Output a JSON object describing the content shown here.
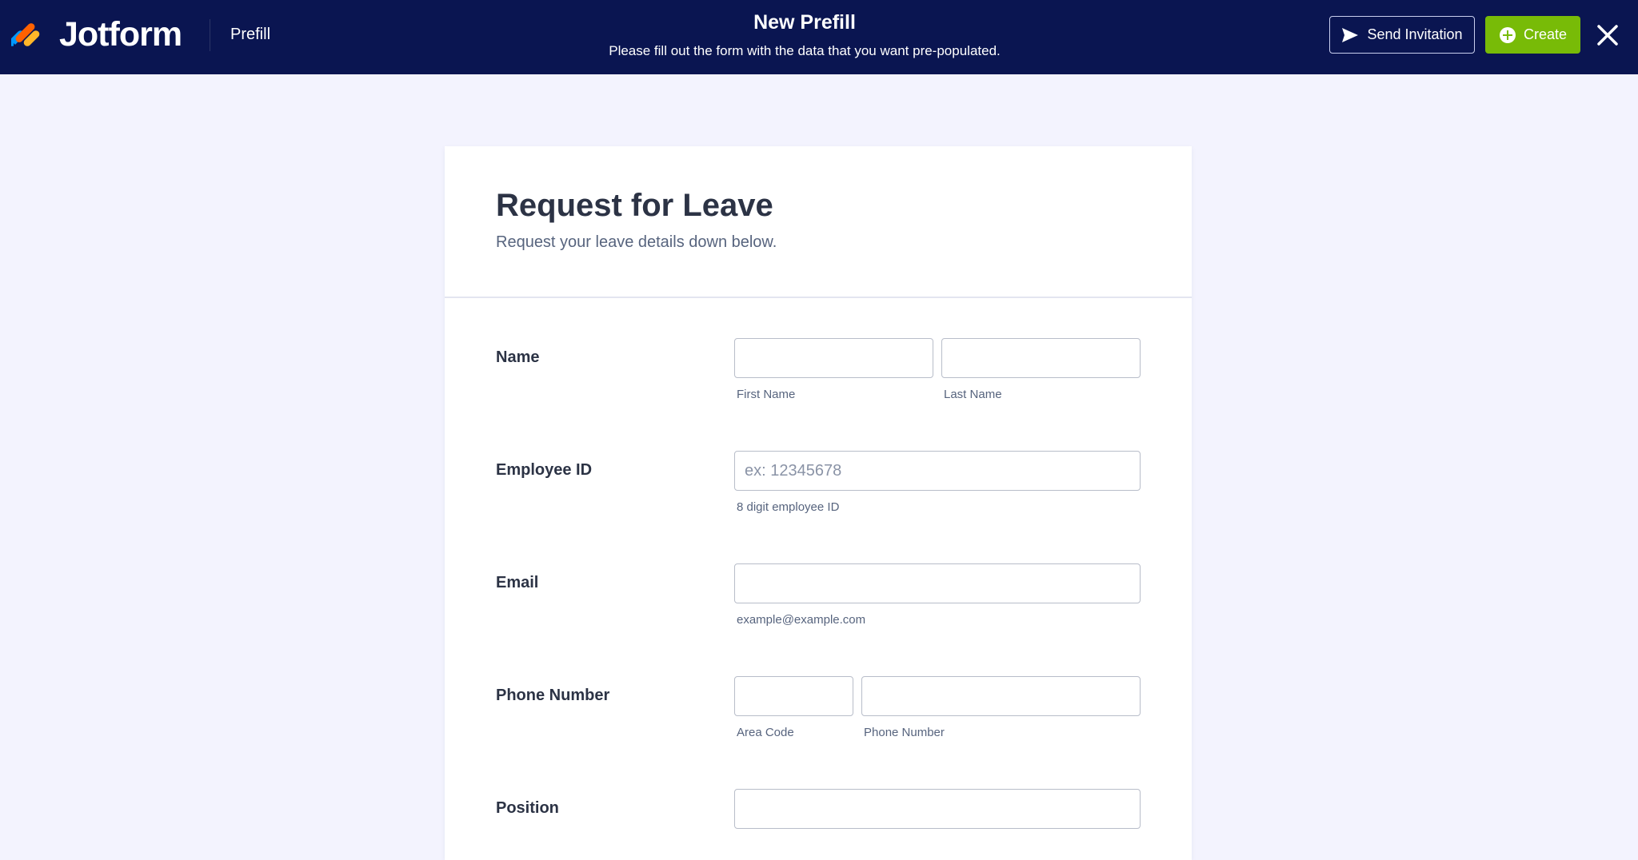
{
  "header": {
    "brand": "Jotform",
    "section": "Prefill",
    "title": "New Prefill",
    "subtitle": "Please fill out the form with the data that you want pre-populated.",
    "send_invitation_label": "Send Invitation",
    "create_label": "Create",
    "icons": [
      "jotform-logo-icon",
      "send-icon",
      "plus-circle-icon",
      "close-icon"
    ]
  },
  "colors": {
    "topbar": "#0a1551",
    "create_button": "#78bb07",
    "page_background": "#f3f3fe",
    "logo_blue": "#0099ff",
    "logo_orange": "#ff6100",
    "logo_yellow": "#ffb629",
    "logo_navy": "#0a1551"
  },
  "form": {
    "title": "Request for Leave",
    "subtitle": "Request your leave details down below.",
    "fields": {
      "name": {
        "label": "Name",
        "first_value": "",
        "first_sublabel": "First Name",
        "last_value": "",
        "last_sublabel": "Last Name"
      },
      "employee_id": {
        "label": "Employee ID",
        "value": "",
        "placeholder": "ex: 12345678",
        "sublabel": "8 digit employee ID"
      },
      "email": {
        "label": "Email",
        "value": "",
        "sublabel": "example@example.com"
      },
      "phone": {
        "label": "Phone Number",
        "area_value": "",
        "area_sublabel": "Area Code",
        "number_value": "",
        "number_sublabel": "Phone Number"
      },
      "position": {
        "label": "Position",
        "value": ""
      }
    }
  }
}
